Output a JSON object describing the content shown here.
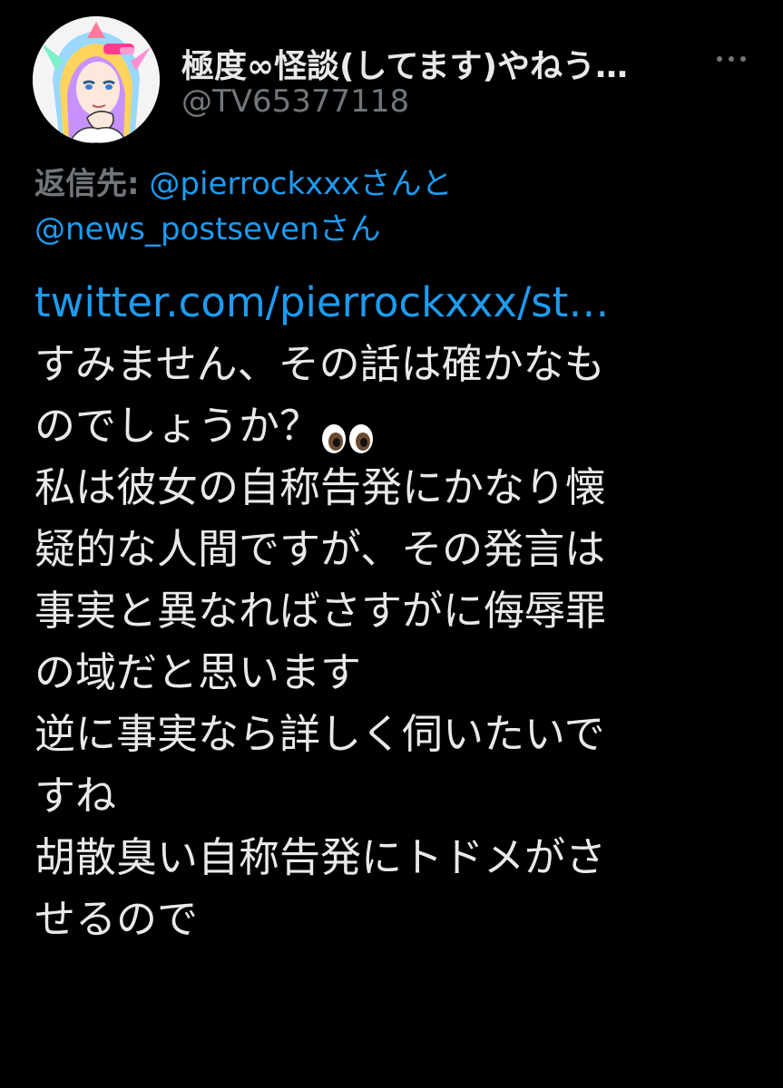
{
  "author": {
    "display_name": "極度∞怪談(してます)やねう…",
    "handle": "@TV65377118"
  },
  "reply_to": {
    "label": "返信先:",
    "mentions": [
      {
        "handle": "@pierrockxxx",
        "suffix": "さんと"
      },
      {
        "handle": "@news_postseven",
        "suffix": "さん"
      }
    ]
  },
  "tweet": {
    "link": "twitter.com/pierrockxxx/st…",
    "lines": [
      "すみません、その話は確かなも",
      "のでしょうか？",
      "私は彼女の自称告発にかなり懐",
      "疑的な人間ですが、その発言は",
      "事実と異なればさすがに侮辱罪",
      "の域だと思います",
      "逆に事実なら詳しく伺いたいで",
      "すね",
      "胡散臭い自称告発にトドメがさ",
      "せるので"
    ],
    "emoji": "eyes-emoji"
  },
  "colors": {
    "background": "#000000",
    "text": "#e7e9ea",
    "muted": "#71767b",
    "accent": "#1d9bf0"
  }
}
